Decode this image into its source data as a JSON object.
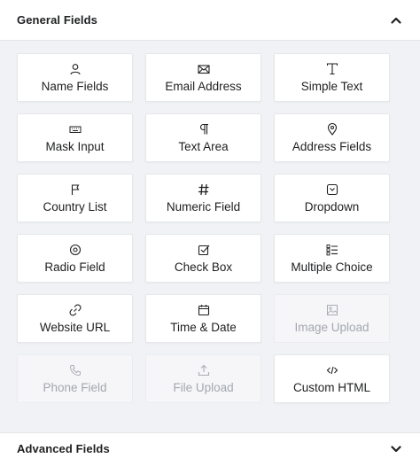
{
  "general": {
    "title": "General Fields",
    "fields": [
      {
        "label": "Name Fields",
        "icon": "user-icon",
        "disabled": false
      },
      {
        "label": "Email Address",
        "icon": "envelope-icon",
        "disabled": false
      },
      {
        "label": "Simple Text",
        "icon": "text-cursor-icon",
        "disabled": false
      },
      {
        "label": "Mask Input",
        "icon": "keyboard-icon",
        "disabled": false
      },
      {
        "label": "Text Area",
        "icon": "paragraph-icon",
        "disabled": false
      },
      {
        "label": "Address Fields",
        "icon": "map-pin-icon",
        "disabled": false
      },
      {
        "label": "Country List",
        "icon": "flag-icon",
        "disabled": false
      },
      {
        "label": "Numeric Field",
        "icon": "hash-icon",
        "disabled": false
      },
      {
        "label": "Dropdown",
        "icon": "dropdown-icon",
        "disabled": false
      },
      {
        "label": "Radio Field",
        "icon": "radio-icon",
        "disabled": false
      },
      {
        "label": "Check Box",
        "icon": "checkbox-icon",
        "disabled": false
      },
      {
        "label": "Multiple Choice",
        "icon": "list-icon",
        "disabled": false
      },
      {
        "label": "Website URL",
        "icon": "link-icon",
        "disabled": false
      },
      {
        "label": "Time & Date",
        "icon": "calendar-icon",
        "disabled": false
      },
      {
        "label": "Image Upload",
        "icon": "image-icon",
        "disabled": true
      },
      {
        "label": "Phone Field",
        "icon": "phone-icon",
        "disabled": true
      },
      {
        "label": "File Upload",
        "icon": "upload-icon",
        "disabled": true
      },
      {
        "label": "Custom HTML",
        "icon": "code-icon",
        "disabled": false
      }
    ]
  },
  "advanced": {
    "title": "Advanced Fields"
  },
  "colors": {
    "text": "#1e1f21",
    "disabled_text": "#a4a7b0",
    "background": "#f1f2f5",
    "card": "#ffffff"
  }
}
